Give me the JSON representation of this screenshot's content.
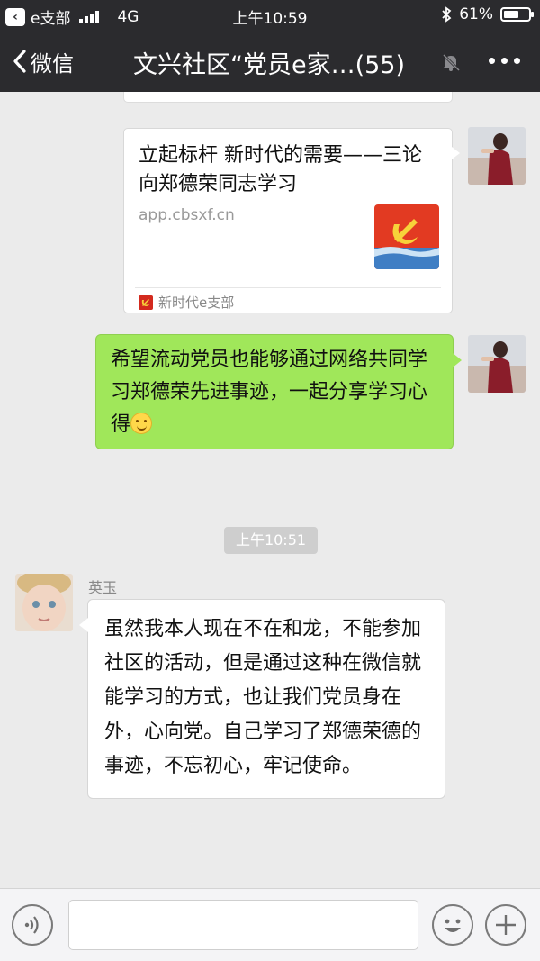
{
  "status_bar": {
    "back_app": "e支部",
    "network": "4G",
    "time": "上午10:59",
    "battery": "61%",
    "battery_level": 0.61
  },
  "nav": {
    "back_label": "微信",
    "title": "文兴社区“党员e家…(55)"
  },
  "messages": {
    "link_card": {
      "title": "立起标杆 新时代的需要——三论向郑德荣同志学习",
      "domain": "app.cbsxf.cn",
      "source": "新时代e支部"
    },
    "green_bubble": {
      "text": "希望流动党员也能够通过网络共同学习郑德荣先进事迹，一起分享学习心得"
    },
    "timestamp": "上午10:51",
    "incoming": {
      "sender": "英玉",
      "text": "虽然我本人现在不在和龙，不能参加社区的活动，但是通过这种在微信就能学习的方式，也让我们党员身在外，心向党。自己学习了郑德荣德的事迹，不忘初心，牢记使命。"
    }
  },
  "input_bar": {
    "placeholder": ""
  },
  "icons": {
    "back": "chevron-left-icon",
    "mute": "mute-bell-icon",
    "more": "more-dots-icon",
    "voice": "voice-icon",
    "emoji": "emoji-icon",
    "plus": "plus-icon"
  },
  "colors": {
    "header": "#2b2b2e",
    "chat_bg": "#ebebeb",
    "sent_bubble": "#a0e75a",
    "received_bubble": "#ffffff",
    "party_red": "#d32a1e"
  }
}
